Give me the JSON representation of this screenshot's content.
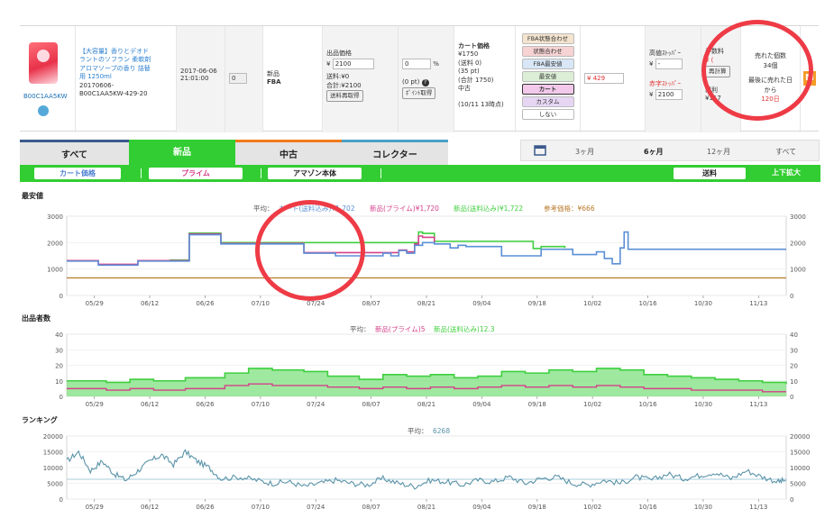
{
  "product": {
    "title": "【大容量】香りとデオドラントのソフラン 柔軟剤 アロマソープの香り 詰替用 1250ml",
    "title_lines": [
      "【大容量】香りとデオド",
      "ラントのソフラン 柔軟剤",
      "アロマソープの香り 詰替",
      "用 1250ml"
    ],
    "sku_lines": [
      "20170606-",
      "B00C1AA5KW-429-20"
    ],
    "asin": "B00C1AA5KW",
    "date": "2017-06-06",
    "time": "21:01:00",
    "qty": "0",
    "condition": "新品",
    "channel": "FBA"
  },
  "pricing": {
    "label": "出品価格",
    "currency": "¥",
    "price": "2100",
    "shipping": "送料:¥0",
    "total": "合計:¥2100",
    "recalc_btn": "送料再取得",
    "percent_value": "0",
    "percent_sign": "%",
    "points": "(0 pt)",
    "point_btn": "ﾎﾟｲﾝﾄ取得"
  },
  "cart": {
    "header": "カート価格",
    "lines": [
      "¥1750",
      "(送料 0)",
      "(35 pt)",
      "(合計 1750)",
      "中古"
    ],
    "updated": "(10/11 13時点)",
    "options": [
      "FBA状態合わせ",
      "状態合わせ",
      "FBA最安値",
      "最安値",
      "カート",
      "カスタム",
      "しない"
    ],
    "red_price": "429"
  },
  "stoppers": {
    "high_label": "高値ｽﾄｯﾊﾟｰ",
    "high_value": "-",
    "low_label": "赤字ｽﾄｯﾊﾟｰ",
    "low_value": "2100",
    "fee_label": "手数料",
    "fee_value": "¥ (",
    "recalc": "再計算",
    "profit_label": "粗利",
    "profit_value": "¥117"
  },
  "sales": {
    "sold_label": "売れた個数",
    "sold_value": "34個",
    "last_label_1": "最後に売れた日",
    "last_label_2": "から",
    "last_value": "120日",
    "badge": "M"
  },
  "tabs": [
    "すべて",
    "新品",
    "中古",
    "コレクター"
  ],
  "periods": [
    "3ヶ月",
    "6ヶ月",
    "12ヶ月",
    "すべて"
  ],
  "filters": {
    "cart": "カート価格",
    "prime": "プライム",
    "amazon": "アマゾン本体",
    "shipping": "送料",
    "zoom": "上下拡大"
  },
  "colors": {
    "accent_green": "#32cd32",
    "cart_blue": "#5b8fd6",
    "prime_pink": "#d6408a",
    "new_green": "#3fcf3f",
    "reference_brown": "#b87a2a",
    "rank_teal": "#5a93a8",
    "highlight_red": "#ee3b46"
  },
  "chart_data": [
    {
      "type": "line",
      "title": "最安値",
      "legend": [
        "平均：",
        "カート(送料込み)¥1,702",
        "新品(プライム)¥1,720",
        "新品(送料込み)¥1,722",
        "参考価格：¥666"
      ],
      "x_ticks": [
        "05/29",
        "06/12",
        "06/26",
        "07/10",
        "07/24",
        "08/07",
        "08/21",
        "09/04",
        "09/18",
        "10/02",
        "10/16",
        "10/30",
        "11/13"
      ],
      "ylim": [
        0,
        3000
      ],
      "y_ticks": [
        0,
        1000,
        2000,
        3000
      ],
      "x_range_days": [
        0,
        182
      ],
      "series": [
        {
          "name": "カート(送料込み)",
          "points": [
            [
              0,
              1300
            ],
            [
              6,
              1300
            ],
            [
              8,
              1150
            ],
            [
              16,
              1150
            ],
            [
              18,
              1300
            ],
            [
              26,
              1300
            ],
            [
              31,
              2300
            ],
            [
              37,
              2300
            ],
            [
              39,
              1950
            ],
            [
              52,
              1950
            ],
            [
              60,
              1600
            ],
            [
              68,
              1500
            ],
            [
              78,
              1500
            ],
            [
              80,
              1600
            ],
            [
              82,
              1500
            ],
            [
              84,
              1700
            ],
            [
              86,
              1600
            ],
            [
              88,
              1900
            ],
            [
              90,
              2000
            ],
            [
              93,
              1950
            ],
            [
              97,
              1800
            ],
            [
              99,
              1900
            ],
            [
              101,
              1850
            ],
            [
              104,
              1850
            ],
            [
              110,
              1500
            ],
            [
              118,
              1500
            ],
            [
              120,
              1750
            ],
            [
              126,
              1750
            ],
            [
              128,
              1550
            ],
            [
              132,
              1550
            ],
            [
              134,
              1650
            ],
            [
              136,
              1400
            ],
            [
              138,
              1200
            ],
            [
              140,
              1800
            ],
            [
              141,
              2400
            ],
            [
              142,
              1750
            ],
            [
              182,
              1750
            ]
          ]
        },
        {
          "name": "新品(プライム)",
          "points": [
            [
              0,
              1320
            ],
            [
              6,
              1320
            ],
            [
              8,
              1180
            ],
            [
              16,
              1180
            ],
            [
              18,
              1320
            ],
            [
              26,
              1320
            ],
            [
              31,
              2330
            ],
            [
              37,
              2330
            ],
            [
              39,
              1970
            ],
            [
              52,
              1970
            ],
            [
              60,
              1620
            ],
            [
              84,
              1720
            ],
            [
              86,
              1650
            ],
            [
              88,
              1950
            ],
            [
              89,
              2250
            ],
            [
              90,
              2200
            ],
            [
              93,
              2000
            ]
          ]
        },
        {
          "name": "新品(送料込み)",
          "points": [
            [
              26,
              1340
            ],
            [
              31,
              2360
            ],
            [
              37,
              2360
            ],
            [
              39,
              2000
            ],
            [
              88,
              2000
            ],
            [
              89,
              2400
            ],
            [
              90,
              2350
            ],
            [
              93,
              2050
            ],
            [
              118,
              1780
            ],
            [
              120,
              1850
            ],
            [
              126,
              1800
            ]
          ]
        },
        {
          "name": "参考価格",
          "points": [
            [
              0,
              666
            ],
            [
              182,
              666
            ]
          ]
        }
      ]
    },
    {
      "type": "area",
      "title": "出品者数",
      "legend": [
        "平均：",
        "新品(プライム)5",
        "新品(送料込み)12.3"
      ],
      "x_ticks": [
        "05/29",
        "06/12",
        "06/26",
        "07/10",
        "07/24",
        "08/07",
        "08/21",
        "09/04",
        "09/18",
        "10/02",
        "10/16",
        "10/30",
        "11/13"
      ],
      "ylim": [
        0,
        40
      ],
      "y_ticks": [
        0,
        10,
        20,
        30,
        40
      ],
      "x_range_days": [
        0,
        182
      ],
      "series": [
        {
          "name": "新品(送料込み)",
          "points": [
            [
              0,
              10
            ],
            [
              10,
              9
            ],
            [
              16,
              11
            ],
            [
              22,
              10
            ],
            [
              30,
              12
            ],
            [
              40,
              15
            ],
            [
              46,
              18
            ],
            [
              52,
              17
            ],
            [
              60,
              16
            ],
            [
              66,
              13
            ],
            [
              74,
              11
            ],
            [
              80,
              14
            ],
            [
              86,
              13
            ],
            [
              92,
              14
            ],
            [
              98,
              12
            ],
            [
              104,
              13
            ],
            [
              110,
              16
            ],
            [
              116,
              15
            ],
            [
              122,
              17
            ],
            [
              128,
              16
            ],
            [
              134,
              18
            ],
            [
              140,
              17
            ],
            [
              146,
              14
            ],
            [
              152,
              13
            ],
            [
              158,
              12
            ],
            [
              164,
              11
            ],
            [
              170,
              10
            ],
            [
              176,
              9
            ],
            [
              182,
              8
            ]
          ]
        },
        {
          "name": "新品(プライム)",
          "points": [
            [
              0,
              5
            ],
            [
              10,
              4
            ],
            [
              16,
              5
            ],
            [
              22,
              4
            ],
            [
              30,
              5
            ],
            [
              40,
              7
            ],
            [
              46,
              8
            ],
            [
              52,
              7
            ],
            [
              60,
              7
            ],
            [
              66,
              6
            ],
            [
              74,
              5
            ],
            [
              80,
              6
            ],
            [
              86,
              5
            ],
            [
              92,
              6
            ],
            [
              98,
              5
            ],
            [
              104,
              6
            ],
            [
              110,
              7
            ],
            [
              116,
              6
            ],
            [
              122,
              7
            ],
            [
              128,
              6
            ],
            [
              134,
              7
            ],
            [
              140,
              6
            ],
            [
              146,
              5
            ],
            [
              152,
              5
            ],
            [
              158,
              4
            ],
            [
              164,
              4
            ],
            [
              170,
              4
            ],
            [
              176,
              3
            ],
            [
              182,
              3
            ]
          ]
        }
      ]
    },
    {
      "type": "line",
      "title": "ランキング",
      "legend": [
        "平均：",
        "6268"
      ],
      "x_ticks": [
        "05/29",
        "06/12",
        "06/26",
        "07/10",
        "07/24",
        "08/07",
        "08/21",
        "09/04",
        "09/18",
        "10/02",
        "10/16",
        "10/30",
        "11/13"
      ],
      "ylim": [
        0,
        20000
      ],
      "y_ticks": [
        0,
        5000,
        10000,
        15000,
        20000
      ],
      "x_range_days": [
        0,
        182
      ],
      "average": 6268,
      "series": [
        {
          "name": "ランキング",
          "points": [
            [
              0,
              12000
            ],
            [
              3,
              15000
            ],
            [
              6,
              9000
            ],
            [
              9,
              12000
            ],
            [
              12,
              8000
            ],
            [
              15,
              6000
            ],
            [
              18,
              9000
            ],
            [
              21,
              12000
            ],
            [
              24,
              14000
            ],
            [
              27,
              11000
            ],
            [
              30,
              15000
            ],
            [
              33,
              12000
            ],
            [
              36,
              10000
            ],
            [
              39,
              6500
            ],
            [
              44,
              7000
            ],
            [
              48,
              6000
            ],
            [
              52,
              5000
            ],
            [
              56,
              5500
            ],
            [
              60,
              4000
            ],
            [
              64,
              5000
            ],
            [
              68,
              6000
            ],
            [
              72,
              5000
            ],
            [
              76,
              4500
            ],
            [
              80,
              6500
            ],
            [
              84,
              5000
            ],
            [
              88,
              4000
            ],
            [
              92,
              6000
            ],
            [
              96,
              5500
            ],
            [
              100,
              4500
            ],
            [
              104,
              6000
            ],
            [
              108,
              5500
            ],
            [
              112,
              7000
            ],
            [
              116,
              5000
            ],
            [
              120,
              6500
            ],
            [
              124,
              7000
            ],
            [
              128,
              5000
            ],
            [
              132,
              4500
            ],
            [
              136,
              6000
            ],
            [
              140,
              5000
            ],
            [
              144,
              7000
            ],
            [
              148,
              6000
            ],
            [
              152,
              8000
            ],
            [
              156,
              6500
            ],
            [
              160,
              7500
            ],
            [
              164,
              8500
            ],
            [
              168,
              6500
            ],
            [
              172,
              9000
            ],
            [
              176,
              7000
            ],
            [
              180,
              5500
            ],
            [
              182,
              6000
            ]
          ]
        }
      ]
    }
  ]
}
